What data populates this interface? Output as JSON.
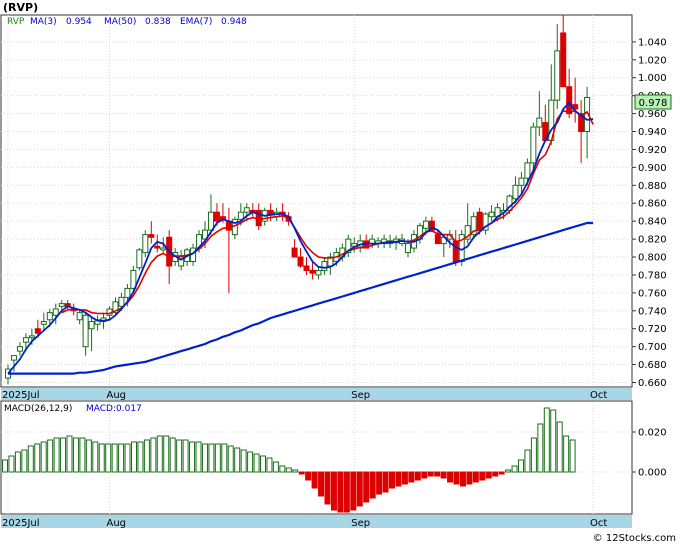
{
  "header": {
    "ticker": "(RVP)",
    "legend": [
      {
        "label": "RVP",
        "value": "",
        "color": "#1a8a1a"
      },
      {
        "label": "MA(3)",
        "value": "0.954",
        "color": "#0000cc"
      },
      {
        "label": "MA(50)",
        "value": "0.838",
        "color": "#0000cc"
      },
      {
        "label": "EMA(7)",
        "value": "0.948",
        "color": "#0000cc"
      }
    ]
  },
  "macd_header": {
    "label": "MACD(26,12,9)",
    "value": "MACD:0.017"
  },
  "footer": {
    "copyright": "© 12Stocks.com"
  },
  "price_tag": "0.978",
  "colors": {
    "up": "#1a6e1a",
    "down": "#dd0000",
    "ma": "#0022cc",
    "ema": "#dd0000",
    "axis_band": "#a9d6e5",
    "tag_bg": "#b8f0b8"
  },
  "chart_data": [
    {
      "type": "candlestick",
      "ylim": [
        0.655,
        1.07
      ],
      "ytick_values": [
        0.66,
        0.68,
        0.7,
        0.72,
        0.74,
        0.76,
        0.78,
        0.8,
        0.82,
        0.84,
        0.86,
        0.88,
        0.9,
        0.92,
        0.94,
        0.96,
        0.98,
        1.0,
        1.02,
        1.04
      ],
      "ytick_labels": [
        "0.660",
        "0.680",
        "0.700",
        "0.720",
        "0.740",
        "0.760",
        "0.780",
        "0.800",
        "0.820",
        "0.840",
        "0.860",
        "0.880",
        "0.900",
        "0.920",
        "0.940",
        "0.960",
        "0.980",
        "1.000",
        "1.020",
        "1.040"
      ],
      "month_labels": [
        {
          "label": "2025Jul",
          "index": 0
        },
        {
          "label": "Aug",
          "index": 17
        },
        {
          "label": "Sep",
          "index": 58
        },
        {
          "label": "Oct",
          "index": 98
        }
      ],
      "ohlc": [
        [
          0.665,
          0.68,
          0.658,
          0.675
        ],
        [
          0.685,
          0.69,
          0.672,
          0.69
        ],
        [
          0.695,
          0.705,
          0.69,
          0.7
        ],
        [
          0.705,
          0.715,
          0.695,
          0.71
        ],
        [
          0.71,
          0.72,
          0.702,
          0.712
        ],
        [
          0.72,
          0.73,
          0.71,
          0.715
        ],
        [
          0.725,
          0.738,
          0.718,
          0.728
        ],
        [
          0.73,
          0.742,
          0.722,
          0.738
        ],
        [
          0.735,
          0.748,
          0.725,
          0.742
        ],
        [
          0.745,
          0.752,
          0.738,
          0.748
        ],
        [
          0.748,
          0.752,
          0.742,
          0.745
        ],
        [
          0.742,
          0.748,
          0.735,
          0.74
        ],
        [
          0.73,
          0.74,
          0.725,
          0.738
        ],
        [
          0.7,
          0.738,
          0.69,
          0.735
        ],
        [
          0.72,
          0.732,
          0.695,
          0.728
        ],
        [
          0.725,
          0.735,
          0.718,
          0.73
        ],
        [
          0.728,
          0.738,
          0.72,
          0.732
        ],
        [
          0.735,
          0.745,
          0.73,
          0.742
        ],
        [
          0.738,
          0.755,
          0.735,
          0.75
        ],
        [
          0.745,
          0.76,
          0.74,
          0.755
        ],
        [
          0.755,
          0.77,
          0.745,
          0.765
        ],
        [
          0.765,
          0.79,
          0.76,
          0.785
        ],
        [
          0.788,
          0.81,
          0.785,
          0.808
        ],
        [
          0.805,
          0.83,
          0.8,
          0.825
        ],
        [
          0.825,
          0.84,
          0.815,
          0.822
        ],
        [
          0.812,
          0.825,
          0.805,
          0.81
        ],
        [
          0.808,
          0.822,
          0.805,
          0.81
        ],
        [
          0.822,
          0.83,
          0.77,
          0.79
        ],
        [
          0.795,
          0.81,
          0.79,
          0.805
        ],
        [
          0.79,
          0.808,
          0.785,
          0.8
        ],
        [
          0.795,
          0.81,
          0.79,
          0.808
        ],
        [
          0.795,
          0.815,
          0.79,
          0.81
        ],
        [
          0.81,
          0.83,
          0.805,
          0.825
        ],
        [
          0.82,
          0.84,
          0.81,
          0.83
        ],
        [
          0.83,
          0.87,
          0.825,
          0.85
        ],
        [
          0.85,
          0.86,
          0.835,
          0.84
        ],
        [
          0.845,
          0.86,
          0.838,
          0.842
        ],
        [
          0.84,
          0.855,
          0.76,
          0.83
        ],
        [
          0.825,
          0.845,
          0.82,
          0.842
        ],
        [
          0.842,
          0.86,
          0.835,
          0.85
        ],
        [
          0.85,
          0.86,
          0.84,
          0.855
        ],
        [
          0.852,
          0.86,
          0.845,
          0.85
        ],
        [
          0.852,
          0.86,
          0.83,
          0.835
        ],
        [
          0.84,
          0.855,
          0.835,
          0.852
        ],
        [
          0.852,
          0.86,
          0.84,
          0.848
        ],
        [
          0.845,
          0.855,
          0.84,
          0.85
        ],
        [
          0.85,
          0.86,
          0.84,
          0.848
        ],
        [
          0.845,
          0.85,
          0.835,
          0.84
        ],
        [
          0.81,
          0.82,
          0.8,
          0.8
        ],
        [
          0.8,
          0.81,
          0.788,
          0.79
        ],
        [
          0.79,
          0.8,
          0.78,
          0.785
        ],
        [
          0.785,
          0.795,
          0.775,
          0.782
        ],
        [
          0.78,
          0.79,
          0.775,
          0.785
        ],
        [
          0.785,
          0.8,
          0.78,
          0.795
        ],
        [
          0.79,
          0.805,
          0.78,
          0.8
        ],
        [
          0.795,
          0.81,
          0.79,
          0.805
        ],
        [
          0.8,
          0.815,
          0.795,
          0.81
        ],
        [
          0.805,
          0.825,
          0.8,
          0.82
        ],
        [
          0.812,
          0.822,
          0.805,
          0.815
        ],
        [
          0.81,
          0.825,
          0.805,
          0.818
        ],
        [
          0.818,
          0.825,
          0.81,
          0.81
        ],
        [
          0.815,
          0.825,
          0.81,
          0.82
        ],
        [
          0.815,
          0.822,
          0.81,
          0.818
        ],
        [
          0.815,
          0.825,
          0.81,
          0.82
        ],
        [
          0.815,
          0.825,
          0.81,
          0.818
        ],
        [
          0.816,
          0.824,
          0.808,
          0.82
        ],
        [
          0.815,
          0.826,
          0.812,
          0.82
        ],
        [
          0.805,
          0.82,
          0.8,
          0.815
        ],
        [
          0.81,
          0.83,
          0.805,
          0.825
        ],
        [
          0.82,
          0.838,
          0.815,
          0.835
        ],
        [
          0.832,
          0.845,
          0.825,
          0.84
        ],
        [
          0.84,
          0.845,
          0.83,
          0.83
        ],
        [
          0.825,
          0.83,
          0.815,
          0.815
        ],
        [
          0.815,
          0.825,
          0.8,
          0.822
        ],
        [
          0.82,
          0.83,
          0.81,
          0.825
        ],
        [
          0.818,
          0.83,
          0.79,
          0.795
        ],
        [
          0.795,
          0.83,
          0.79,
          0.825
        ],
        [
          0.82,
          0.86,
          0.815,
          0.835
        ],
        [
          0.825,
          0.85,
          0.82,
          0.845
        ],
        [
          0.85,
          0.855,
          0.825,
          0.83
        ],
        [
          0.83,
          0.85,
          0.825,
          0.848
        ],
        [
          0.845,
          0.858,
          0.84,
          0.85
        ],
        [
          0.845,
          0.86,
          0.84,
          0.855
        ],
        [
          0.85,
          0.86,
          0.842,
          0.852
        ],
        [
          0.852,
          0.87,
          0.848,
          0.868
        ],
        [
          0.865,
          0.89,
          0.86,
          0.88
        ],
        [
          0.88,
          0.895,
          0.87,
          0.888
        ],
        [
          0.888,
          0.91,
          0.88,
          0.905
        ],
        [
          0.905,
          0.95,
          0.895,
          0.945
        ],
        [
          0.945,
          0.985,
          0.935,
          0.955
        ],
        [
          0.95,
          0.97,
          0.935,
          0.93
        ],
        [
          0.93,
          1.015,
          0.925,
          0.975
        ],
        [
          0.975,
          1.06,
          0.965,
          1.03
        ],
        [
          1.05,
          1.07,
          1.0,
          0.99
        ],
        [
          0.99,
          1.01,
          0.955,
          0.96
        ],
        [
          0.97,
          1.0,
          0.95,
          0.965
        ],
        [
          0.96,
          0.975,
          0.905,
          0.94
        ],
        [
          0.94,
          0.99,
          0.91,
          0.978
        ]
      ],
      "ma3": [
        0.67,
        0.678,
        0.686,
        0.697,
        0.706,
        0.712,
        0.718,
        0.724,
        0.732,
        0.74,
        0.745,
        0.743,
        0.741,
        0.738,
        0.733,
        0.729,
        0.729,
        0.73,
        0.735,
        0.742,
        0.75,
        0.761,
        0.777,
        0.793,
        0.81,
        0.817,
        0.815,
        0.806,
        0.801,
        0.797,
        0.801,
        0.804,
        0.811,
        0.818,
        0.828,
        0.838,
        0.842,
        0.84,
        0.838,
        0.84,
        0.846,
        0.85,
        0.848,
        0.846,
        0.847,
        0.848,
        0.848,
        0.845,
        0.832,
        0.818,
        0.806,
        0.795,
        0.789,
        0.788,
        0.789,
        0.793,
        0.8,
        0.807,
        0.811,
        0.814,
        0.815,
        0.815,
        0.815,
        0.816,
        0.817,
        0.817,
        0.818,
        0.817,
        0.817,
        0.82,
        0.827,
        0.833,
        0.83,
        0.823,
        0.816,
        0.811,
        0.808,
        0.812,
        0.822,
        0.828,
        0.834,
        0.838,
        0.845,
        0.849,
        0.856,
        0.862,
        0.87,
        0.883,
        0.897,
        0.915,
        0.93,
        0.942,
        0.95,
        0.965,
        0.972,
        0.963,
        0.958,
        0.953,
        0.954
      ],
      "ema7": [
        null,
        null,
        null,
        null,
        null,
        null,
        null,
        null,
        null,
        0.738,
        0.741,
        0.742,
        0.741,
        0.741,
        0.738,
        0.737,
        0.737,
        0.737,
        0.74,
        0.743,
        0.749,
        0.757,
        0.768,
        0.782,
        0.794,
        0.801,
        0.804,
        0.8,
        0.801,
        0.801,
        0.802,
        0.804,
        0.809,
        0.815,
        0.823,
        0.828,
        0.832,
        0.833,
        0.835,
        0.838,
        0.842,
        0.844,
        0.842,
        0.843,
        0.844,
        0.845,
        0.846,
        0.843,
        0.833,
        0.822,
        0.812,
        0.805,
        0.8,
        0.799,
        0.799,
        0.8,
        0.803,
        0.807,
        0.809,
        0.811,
        0.811,
        0.813,
        0.815,
        0.816,
        0.816,
        0.817,
        0.818,
        0.817,
        0.819,
        0.823,
        0.828,
        0.829,
        0.826,
        0.825,
        0.825,
        0.817,
        0.819,
        0.823,
        0.829,
        0.83,
        0.834,
        0.838,
        0.842,
        0.845,
        0.851,
        0.858,
        0.866,
        0.876,
        0.893,
        0.908,
        0.914,
        0.929,
        0.954,
        0.963,
        0.962,
        0.963,
        0.957,
        0.962,
        0.948
      ],
      "ma50": [
        0.67,
        0.67,
        0.67,
        0.67,
        0.67,
        0.67,
        0.67,
        0.67,
        0.67,
        0.67,
        0.67,
        0.67,
        0.671,
        0.671,
        0.672,
        0.673,
        0.674,
        0.676,
        0.678,
        0.679,
        0.68,
        0.681,
        0.682,
        0.683,
        0.685,
        0.687,
        0.689,
        0.691,
        0.693,
        0.695,
        0.697,
        0.699,
        0.701,
        0.703,
        0.706,
        0.708,
        0.711,
        0.713,
        0.716,
        0.718,
        0.721,
        0.724,
        0.726,
        0.729,
        0.732,
        0.734,
        0.736,
        0.738,
        0.74,
        0.742,
        0.744,
        0.746,
        0.748,
        0.75,
        0.752,
        0.754,
        0.756,
        0.758,
        0.76,
        0.762,
        0.764,
        0.766,
        0.768,
        0.77,
        0.772,
        0.774,
        0.776,
        0.778,
        0.78,
        0.782,
        0.784,
        0.786,
        0.788,
        0.79,
        0.792,
        0.794,
        0.796,
        0.798,
        0.8,
        0.802,
        0.804,
        0.806,
        0.808,
        0.81,
        0.812,
        0.814,
        0.816,
        0.818,
        0.82,
        0.822,
        0.824,
        0.826,
        0.828,
        0.83,
        0.832,
        0.834,
        0.836,
        0.838,
        0.838
      ]
    },
    {
      "type": "bar",
      "title": "MACD(26,12,9)",
      "ylim": [
        -0.021,
        0.035
      ],
      "ytick_values": [
        0.0,
        0.02
      ],
      "ytick_labels": [
        "0.000",
        "0.020"
      ],
      "values": [
        0.006,
        0.008,
        0.01,
        0.011,
        0.013,
        0.014,
        0.015,
        0.016,
        0.017,
        0.017,
        0.018,
        0.017,
        0.017,
        0.016,
        0.015,
        0.014,
        0.014,
        0.014,
        0.014,
        0.014,
        0.015,
        0.015,
        0.016,
        0.017,
        0.018,
        0.018,
        0.017,
        0.016,
        0.016,
        0.015,
        0.015,
        0.014,
        0.014,
        0.014,
        0.014,
        0.013,
        0.012,
        0.011,
        0.01,
        0.009,
        0.008,
        0.007,
        0.005,
        0.003,
        0.002,
        0.001,
        -0.001,
        -0.004,
        -0.008,
        -0.012,
        -0.016,
        -0.019,
        -0.02,
        -0.02,
        -0.019,
        -0.017,
        -0.015,
        -0.013,
        -0.011,
        -0.01,
        -0.008,
        -0.007,
        -0.006,
        -0.005,
        -0.004,
        -0.003,
        -0.002,
        -0.002,
        -0.003,
        -0.005,
        -0.006,
        -0.007,
        -0.006,
        -0.005,
        -0.004,
        -0.003,
        -0.002,
        -0.001,
        0.001,
        0.003,
        0.006,
        0.011,
        0.017,
        0.024,
        0.032,
        0.031,
        0.025,
        0.018,
        0.016
      ]
    }
  ]
}
